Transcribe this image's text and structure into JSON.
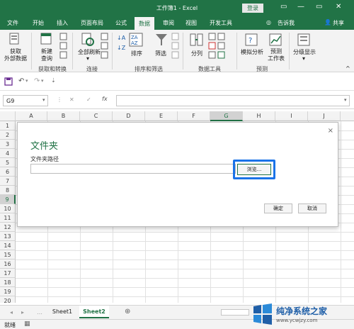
{
  "window": {
    "title": "工作簿1 - Excel",
    "login": "登录",
    "min": "—",
    "max": "▭",
    "close": "✕"
  },
  "tabs": [
    "文件",
    "开始",
    "插入",
    "页面布局",
    "公式",
    "数据",
    "审阅",
    "视图",
    "开发工具"
  ],
  "active_tab": "数据",
  "tell_me": "告诉我",
  "share": "共享",
  "ribbon": {
    "get_external": "获取\n外部数据",
    "new_query": "新建\n查询",
    "refresh_all": "全部刷新",
    "sort": "排序",
    "filter": "筛选",
    "split": "分列",
    "whatif": "模拟分析",
    "forecast": "预测\n工作表",
    "outline": "分级显示",
    "groups": [
      "获取和转换",
      "连接",
      "排序和筛选",
      "数据工具",
      "预测"
    ]
  },
  "formula_bar": {
    "name_box": "G9",
    "fx": "fx",
    "cancel": "✕",
    "enter": "✓"
  },
  "grid": {
    "columns": [
      "A",
      "B",
      "C",
      "D",
      "E",
      "F",
      "G",
      "H",
      "I",
      "J"
    ],
    "rows": [
      "1",
      "2",
      "3",
      "4",
      "5",
      "6",
      "7",
      "8",
      "9",
      "10",
      "11",
      "12",
      "13",
      "14",
      "15",
      "16",
      "17",
      "18",
      "19",
      "20",
      "21"
    ],
    "selected_col": "G",
    "selected_row": "9"
  },
  "dialog": {
    "title": "文件夹",
    "path_label": "文件夹路径",
    "path_value": "",
    "browse": "浏览...",
    "ok": "确定",
    "cancel": "取消",
    "close": "×"
  },
  "sheets": [
    "Sheet1",
    "Sheet2"
  ],
  "active_sheet": "Sheet2",
  "status": "就绪",
  "watermark": {
    "line1": "纯净系统之家",
    "line2": "www.ycwjzy.com"
  }
}
